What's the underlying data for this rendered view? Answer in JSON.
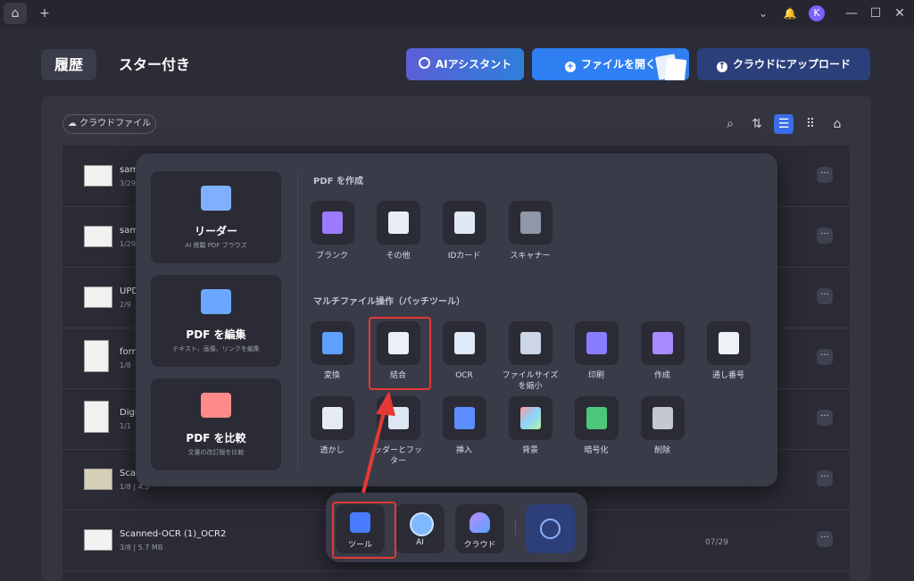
{
  "titlebar": {
    "add_tab": "+",
    "avatar_letter": "K",
    "minimize": "—",
    "maximize": "☐",
    "close": "✕",
    "bell": "🔔",
    "chevron": "⌄",
    "home": "⌂"
  },
  "header": {
    "tabs": [
      {
        "label": "履歴"
      },
      {
        "label": "スター付き"
      }
    ],
    "buttons": {
      "ai": "AIアシスタント",
      "open": "ファイルを開く",
      "cloud": "クラウドにアップロード"
    }
  },
  "toolbar": {
    "cloud_files": "クラウドファイル"
  },
  "files": [
    {
      "name": "sam",
      "meta": "3/29",
      "date": ""
    },
    {
      "name": "sam",
      "meta": "1/29",
      "date": ""
    },
    {
      "name": "UPD",
      "meta": "2/9",
      "date": ""
    },
    {
      "name": "forr",
      "meta": "1/8",
      "date": ""
    },
    {
      "name": "Digi",
      "meta": "1/1",
      "date": ""
    },
    {
      "name": "Scan",
      "meta": "1/8 | 4.5",
      "date": ""
    },
    {
      "name": "Scanned-OCR (1)_OCR2",
      "meta": "3/8 | 5.7 MB",
      "date": "07/29"
    }
  ],
  "popup": {
    "left_cards": [
      {
        "title": "リーダー",
        "subtitle": "AI 搭載 PDF ブラウズ"
      },
      {
        "title": "PDF を編集",
        "subtitle": "テキスト、画像、リンクを編集"
      },
      {
        "title": "PDF を比較",
        "subtitle": "文書の改訂版を比較"
      }
    ],
    "create_section": {
      "title": "PDF を作成",
      "tools": [
        {
          "label": "ブランク",
          "icon": "blank-page-icon"
        },
        {
          "label": "その他",
          "icon": "other-files-icon"
        },
        {
          "label": "IDカード",
          "icon": "id-card-icon"
        },
        {
          "label": "スキャナー",
          "icon": "scanner-icon"
        }
      ]
    },
    "batch_section": {
      "title": "マルチファイル操作（バッチツール）",
      "tools": [
        {
          "label": "変換",
          "icon": "convert-icon"
        },
        {
          "label": "結合",
          "icon": "combine-icon"
        },
        {
          "label": "OCR",
          "icon": "ocr-icon"
        },
        {
          "label": "ファイルサイズを縮小",
          "label_line1": "ファイルサイズ",
          "label_line2": "を縮小",
          "icon": "compress-icon"
        },
        {
          "label": "印刷",
          "icon": "print-icon"
        },
        {
          "label": "作成",
          "icon": "create-icon"
        },
        {
          "label": "通し番号",
          "icon": "bates-number-icon"
        },
        {
          "label": "透かし",
          "icon": "watermark-icon"
        },
        {
          "label": "ッダーとフッター",
          "label_line1": "ッダーとフッ",
          "label_line2": "ター",
          "icon": "header-footer-icon"
        },
        {
          "label": "挿入",
          "icon": "insert-icon"
        },
        {
          "label": "背景",
          "icon": "background-icon"
        },
        {
          "label": "暗号化",
          "icon": "encrypt-icon"
        },
        {
          "label": "削除",
          "icon": "delete-icon"
        }
      ]
    }
  },
  "dock": {
    "items": [
      {
        "label": "ツール"
      },
      {
        "label": "AI"
      },
      {
        "label": "クラウド"
      }
    ]
  },
  "colors": {
    "accent": "#2f7ff2",
    "highlight": "#e53935",
    "background": "#2b2c36"
  }
}
